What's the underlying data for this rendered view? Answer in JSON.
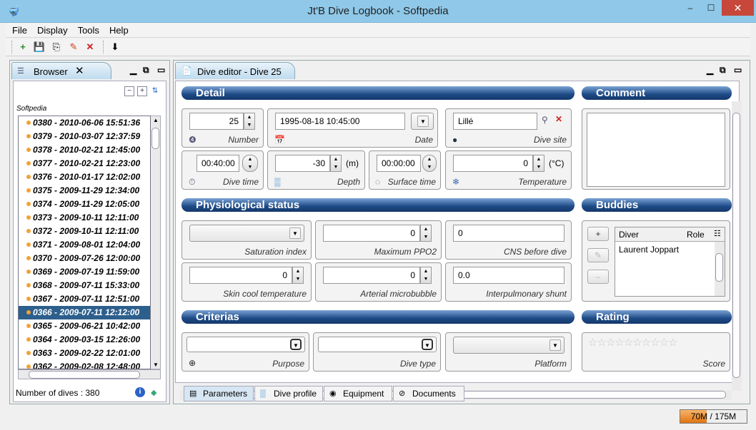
{
  "window": {
    "title": "Jt'B Dive Logbook - Softpedia",
    "controls": {
      "minimize": "–",
      "maximize": "☐",
      "close": "✕"
    }
  },
  "menu": [
    "File",
    "Display",
    "Tools",
    "Help"
  ],
  "toolbar": {
    "icons": [
      "new-dive-icon",
      "save-icon",
      "save-all-icon",
      "edit-icon",
      "delete-icon",
      "import-icon"
    ],
    "glyphs": [
      "+",
      "💾",
      "⎘",
      "✎",
      "✕",
      "⬇"
    ]
  },
  "browser": {
    "tab_label": "Browser",
    "root": "Softpedia",
    "dives": [
      "0380 - 2010-06-06 15:51:36",
      "0379 - 2010-03-07 12:37:59",
      "0378 - 2010-02-21 12:45:00",
      "0377 - 2010-02-21 12:23:00",
      "0376 - 2010-01-17 12:02:00",
      "0375 - 2009-11-29 12:34:00",
      "0374 - 2009-11-29 12:05:00",
      "0373 - 2009-10-11 12:11:00",
      "0372 - 2009-10-11 12:11:00",
      "0371 - 2009-08-01 12:04:00",
      "0370 - 2009-07-26 12:00:00",
      "0369 - 2009-07-19 11:59:00",
      "0368 - 2009-07-11 15:33:00",
      "0367 - 2009-07-11 12:51:00",
      "0366 - 2009-07-11 12:12:00",
      "0365 - 2009-06-21 10:42:00",
      "0364 - 2009-03-15 12:26:00",
      "0363 - 2009-02-22 12:01:00",
      "0362 - 2009-02-08 12:48:00"
    ],
    "selected_index": 14,
    "count_label": "Number of dives : 380"
  },
  "editor": {
    "tab_label": "Dive editor - Dive 25",
    "sections": {
      "detail": "Detail",
      "comment": "Comment",
      "physio": "Physiological status",
      "buddies": "Buddies",
      "criterias": "Criterias",
      "rating": "Rating"
    },
    "detail": {
      "number": {
        "value": "25",
        "label": "Number"
      },
      "date": {
        "value": "1995-08-18 10:45:00",
        "label": "Date"
      },
      "dive_site": {
        "value": "Lillé",
        "label": "Dive site"
      },
      "dive_time": {
        "value": "00:40:00",
        "label": "Dive time"
      },
      "depth": {
        "value": "-30",
        "unit": "(m)",
        "label": "Depth"
      },
      "surface_time": {
        "value": "00:00:00",
        "label": "Surface time"
      },
      "temperature": {
        "value": "0",
        "unit": "(°C)",
        "label": "Temperature"
      }
    },
    "physio": {
      "saturation_index": {
        "label": "Saturation index"
      },
      "max_ppo2": {
        "value": "0",
        "label": "Maximum PPO2"
      },
      "cns_before": {
        "value": "0",
        "label": "CNS before dive"
      },
      "skin_cool": {
        "value": "0",
        "label": "Skin cool temperature"
      },
      "arterial_microbubble": {
        "value": "0",
        "label": "Arterial microbubble"
      },
      "interpulmonary_shunt": {
        "value": "0.0",
        "label": "Interpulmonary shunt"
      }
    },
    "buddies": {
      "columns": [
        "Diver",
        "Role"
      ],
      "rows": [
        {
          "diver": "Laurent Joppart",
          "role": ""
        }
      ],
      "buttons": {
        "add": "+",
        "edit": "✎",
        "remove": "–"
      }
    },
    "criterias": {
      "purpose": {
        "label": "Purpose"
      },
      "dive_type": {
        "label": "Dive type"
      },
      "platform": {
        "label": "Platform"
      }
    },
    "rating": {
      "stars": "☆☆☆☆☆☆☆☆☆☆",
      "score": 0,
      "max": 10,
      "label": "Score"
    },
    "bottom_tabs": [
      "Parameters",
      "Dive profile",
      "Equipment",
      "Documents"
    ],
    "active_bottom_tab": "Parameters"
  },
  "memory": {
    "label": "70M / 175M",
    "used_fraction": 0.4
  }
}
